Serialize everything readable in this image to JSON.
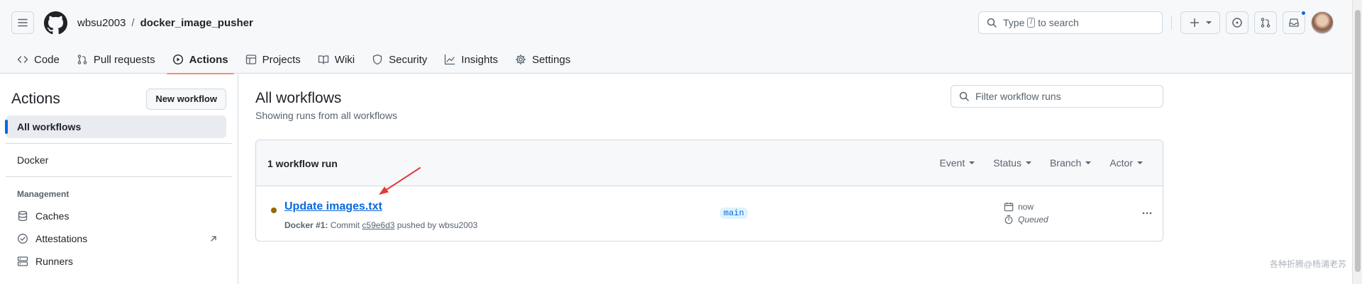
{
  "header": {
    "owner": "wbsu2003",
    "separator": "/",
    "repo": "docker_image_pusher",
    "search_prefix": "Type",
    "search_key": "/",
    "search_suffix": "to search",
    "notification_dot_color": "#0969da"
  },
  "tabs": [
    {
      "label": "Code",
      "icon": "code-icon"
    },
    {
      "label": "Pull requests",
      "icon": "pull-request-icon"
    },
    {
      "label": "Actions",
      "icon": "play-icon",
      "active": true
    },
    {
      "label": "Projects",
      "icon": "table-icon"
    },
    {
      "label": "Wiki",
      "icon": "book-icon"
    },
    {
      "label": "Security",
      "icon": "shield-icon"
    },
    {
      "label": "Insights",
      "icon": "graph-icon"
    },
    {
      "label": "Settings",
      "icon": "gear-icon"
    }
  ],
  "sidebar": {
    "title": "Actions",
    "new_workflow_label": "New workflow",
    "all_workflows": "All workflows",
    "workflow_docker": "Docker",
    "management_heading": "Management",
    "caches": "Caches",
    "attestations": "Attestations",
    "runners": "Runners"
  },
  "main": {
    "title": "All workflows",
    "subtitle": "Showing runs from all workflows",
    "filter_placeholder": "Filter workflow runs",
    "run_count": "1 workflow run",
    "filters": [
      "Event",
      "Status",
      "Branch",
      "Actor"
    ]
  },
  "run": {
    "title": "Update images.txt",
    "workflow": "Docker #1:",
    "commit_label": "Commit",
    "commit_sha": "c59e6d3",
    "pushed_by": "pushed by wbsu2003",
    "branch": "main",
    "time": "now",
    "status": "Queued",
    "status_color": "#9a6700"
  },
  "watermark": "各种折腾@杨浦老苏",
  "colors": {
    "accent": "#0969da",
    "tab_underline": "#fd8c73",
    "annotation_arrow": "#e53935"
  }
}
